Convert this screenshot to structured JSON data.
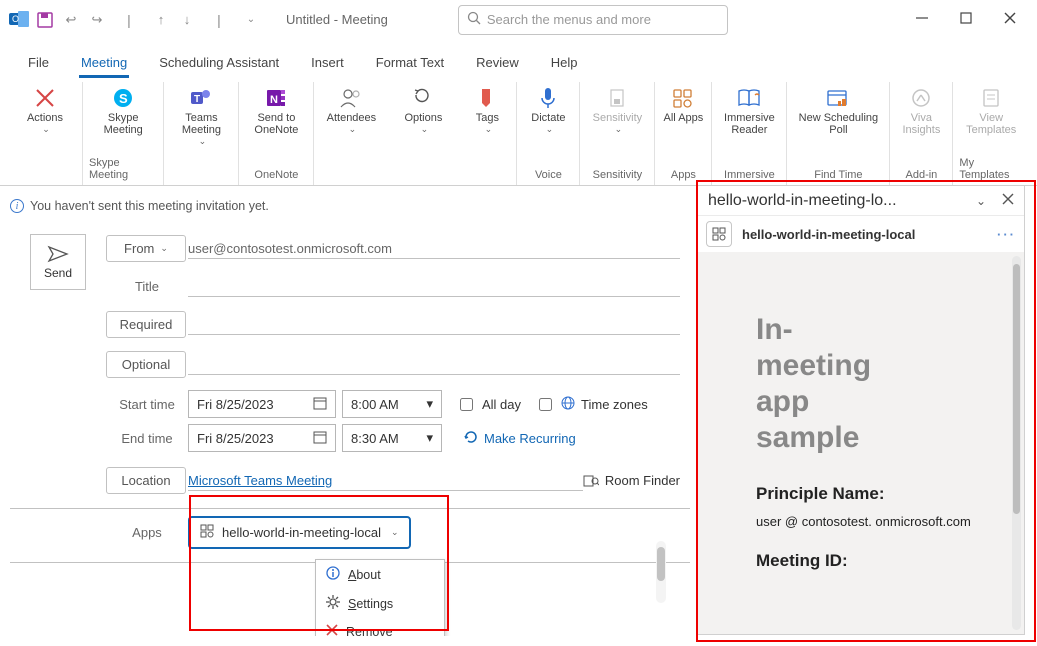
{
  "titlebar": {
    "title": "Untitled  -  Meeting",
    "search_placeholder": "Search the menus and more"
  },
  "tabs": {
    "file": "File",
    "meeting": "Meeting",
    "scheduling": "Scheduling Assistant",
    "insert": "Insert",
    "format": "Format Text",
    "review": "Review",
    "help": "Help"
  },
  "ribbon": {
    "actions": "Actions",
    "skype": "Skype Meeting",
    "teams": "Teams Meeting",
    "onenote": "Send to OneNote",
    "attendees": "Attendees",
    "options": "Options",
    "tags": "Tags",
    "dictate": "Dictate",
    "sensitivity": "Sensitivity",
    "allapps": "All Apps",
    "immersive": "Immersive Reader",
    "schedpoll": "New Scheduling Poll",
    "viva": "Viva Insights",
    "templates": "View Templates",
    "groups": {
      "skype": "Skype Meeting",
      "onenote": "OneNote",
      "voice": "Voice",
      "sensitivity": "Sensitivity",
      "apps": "Apps",
      "immersive": "Immersive",
      "findtime": "Find Time",
      "addin": "Add-in",
      "templates": "My Templates"
    }
  },
  "infobar": {
    "text": "You haven't sent this meeting invitation yet."
  },
  "form": {
    "send": "Send",
    "from": "From",
    "from_value": "user@contosotest.onmicrosoft.com",
    "title": "Title",
    "required": "Required",
    "optional": "Optional",
    "start": "Start time",
    "end": "End time",
    "start_date": "Fri 8/25/2023",
    "start_time": "8:00 AM",
    "end_date": "Fri 8/25/2023",
    "end_time": "8:30 AM",
    "allday": "All day",
    "timezones": "Time zones",
    "recurring": "Make Recurring",
    "location": "Location",
    "location_value": "Microsoft Teams Meeting",
    "roomfinder": "Room Finder",
    "apps": "Apps",
    "app_name": "hello-world-in-meeting-local"
  },
  "menu": {
    "about": "About",
    "settings": "Settings",
    "remove": "Remove"
  },
  "sidepanel": {
    "title_truncated": "hello-world-in-meeting-lo...",
    "app_label": "hello-world-in-meeting-local",
    "heading": "In-meeting app sample",
    "principle_label": "Principle Name:",
    "principle_value": "user @ contosotest. onmicrosoft.com",
    "meeting_id_label": "Meeting ID:"
  }
}
